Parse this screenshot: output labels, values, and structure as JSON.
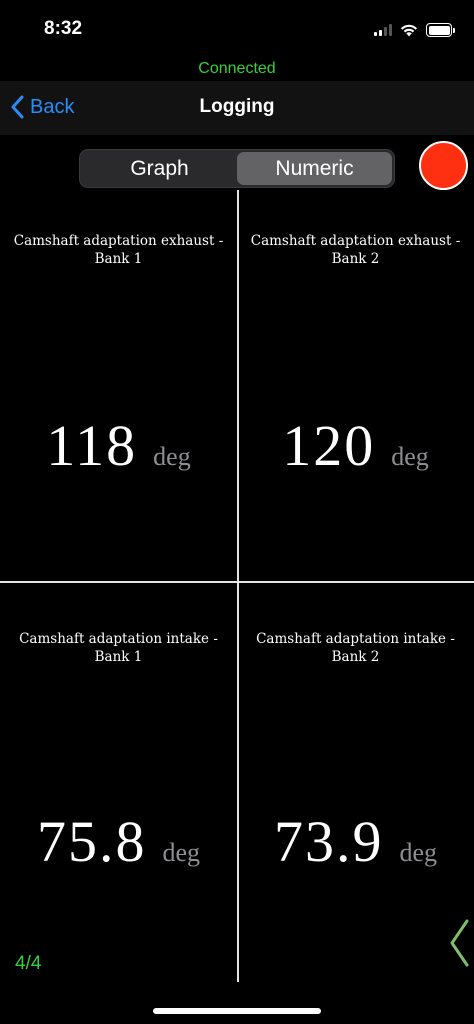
{
  "status_bar": {
    "time": "8:32",
    "icons": [
      "cellular-signal-icon",
      "wifi-icon",
      "battery-icon"
    ]
  },
  "connection": {
    "status": "Connected",
    "color": "#35d03b"
  },
  "nav": {
    "back_label": "Back",
    "title": "Logging",
    "accent_color": "#2b8cf5"
  },
  "segmented": {
    "options": [
      "Graph",
      "Numeric"
    ],
    "selected": "Numeric"
  },
  "record_button": {
    "color": "#ff2f12",
    "icon": "record-icon"
  },
  "cells": [
    {
      "label_line1": "Camshaft adaptation exhaust  -",
      "label_line2": "Bank 1",
      "value": "118",
      "unit": "deg"
    },
    {
      "label_line1": "Camshaft adaptation exhaust  -",
      "label_line2": "Bank 2",
      "value": "120",
      "unit": "deg"
    },
    {
      "label_line1": "Camshaft adaptation intake  -",
      "label_line2": "Bank 1",
      "value": "75.8",
      "unit": "deg"
    },
    {
      "label_line1": "Camshaft adaptation intake  -",
      "label_line2": "Bank 2",
      "value": "73.9",
      "unit": "deg"
    }
  ],
  "page_indicator": "4/4",
  "page_arrow": {
    "icon": "chevron-left-icon",
    "color": "#7fbf6a"
  }
}
